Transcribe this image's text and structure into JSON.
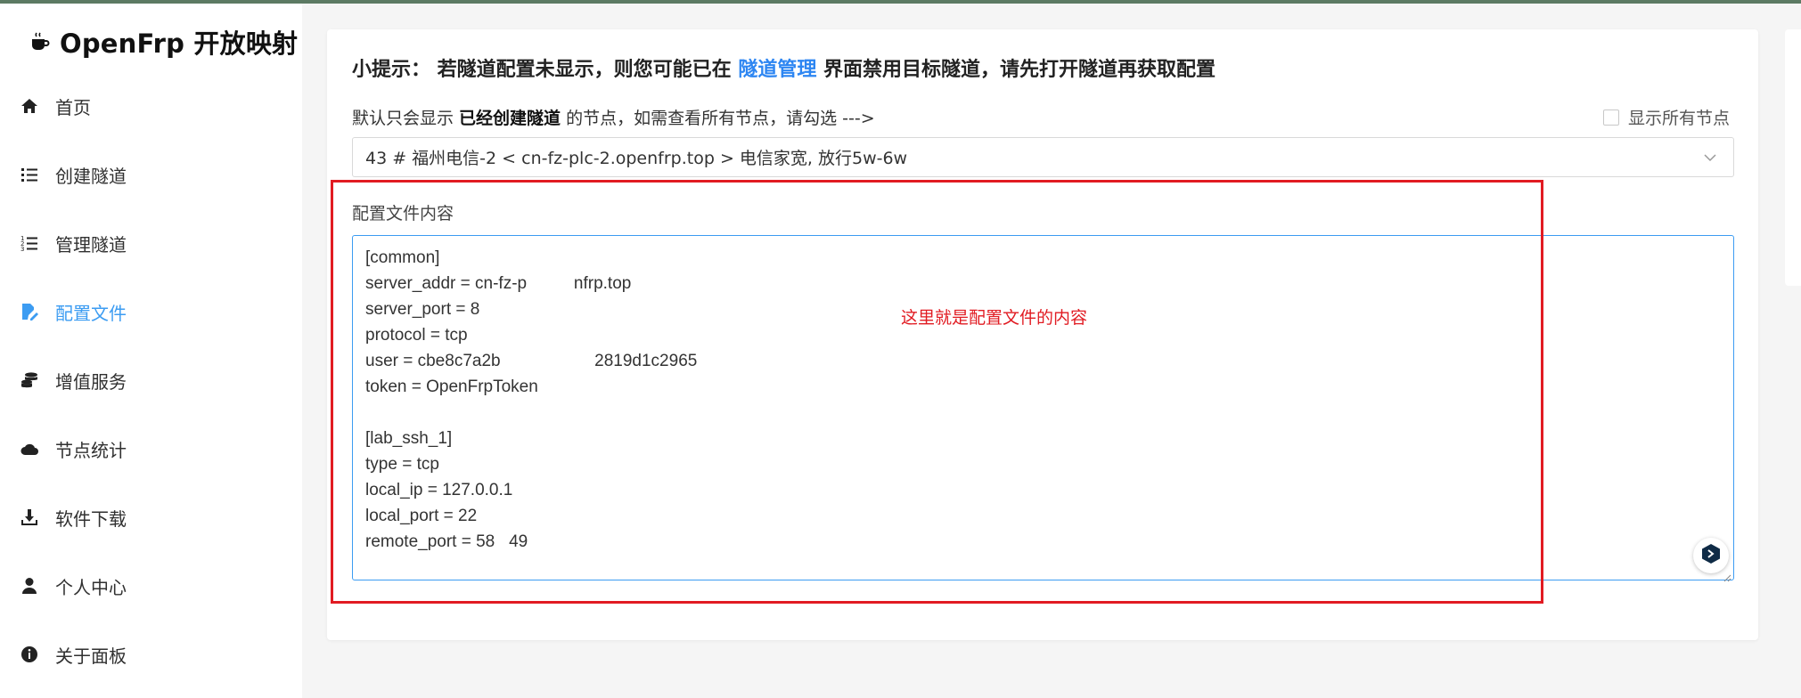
{
  "app": {
    "title": "OpenFrp 开放映射"
  },
  "sidebar": {
    "items": [
      {
        "label": "首页",
        "icon": "home-icon"
      },
      {
        "label": "创建隧道",
        "icon": "list-icon"
      },
      {
        "label": "管理隧道",
        "icon": "ordered-list-icon"
      },
      {
        "label": "配置文件",
        "icon": "file-edit-icon",
        "active": true
      },
      {
        "label": "增值服务",
        "icon": "coins-icon"
      },
      {
        "label": "节点统计",
        "icon": "cloud-icon"
      },
      {
        "label": "软件下载",
        "icon": "download-icon"
      },
      {
        "label": "个人中心",
        "icon": "user-icon"
      },
      {
        "label": "关于面板",
        "icon": "info-icon"
      }
    ]
  },
  "main": {
    "tip": {
      "prefix": "小提示：  若隧道配置未显示，则您可能已在 ",
      "link": "隧道管理",
      "suffix": " 界面禁用目标隧道，请先打开隧道再获取配置"
    },
    "hint": {
      "prefix": "默认只会显示 ",
      "bold": "已经创建隧道",
      "suffix": " 的节点，如需查看所有节点，请勾选 --->"
    },
    "show_all_label": "显示所有节点",
    "node_select_value": "43 # 福州电信-2 < cn-fz-plc-2.openfrp.top > 电信家宽, 放行5w-6w",
    "config_label": "配置文件内容",
    "config_lines": [
      "[common]",
      "server_addr = cn-fz-p          nfrp.top",
      "server_port = 8",
      "protocol = tcp",
      "user = cbe8c7a2b                    2819d1c2965",
      "token = OpenFrpToken",
      "",
      "[lab_ssh_1]",
      "type = tcp",
      "local_ip = 127.0.0.1",
      "local_port = 22",
      "remote_port = 58   49"
    ]
  },
  "annotation": {
    "text": "这里就是配置文件的内容",
    "color": "#e11b22"
  },
  "colors": {
    "accent": "#3c9cf2",
    "link": "#2d86f2",
    "annotation": "#e11b22"
  }
}
